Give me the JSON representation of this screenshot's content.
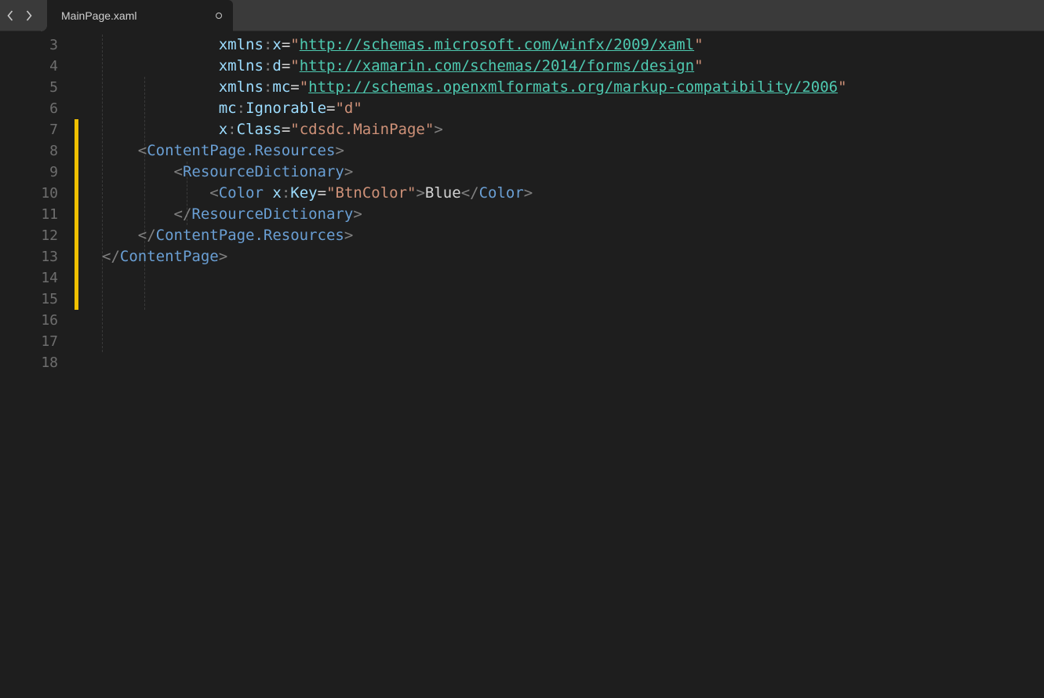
{
  "tab": {
    "label": "MainPage.xaml"
  },
  "lines": {
    "start": 3,
    "end": 18,
    "modified": [
      7,
      8,
      9,
      10,
      11,
      12,
      13,
      14,
      15
    ]
  },
  "code": {
    "l3": {
      "prefix": "xmlns",
      "ns": "x",
      "url": "http://schemas.microsoft.com/winfx/2009/xaml"
    },
    "l4": {
      "prefix": "xmlns",
      "ns": "d",
      "url": "http://xamarin.com/schemas/2014/forms/design"
    },
    "l5": {
      "prefix": "xmlns",
      "ns": "mc",
      "url": "http://schemas.openxmlformats.org/markup-compatibility/2006"
    },
    "l6": {
      "attr_ns": "mc",
      "attr": "Ignorable",
      "val": "d"
    },
    "l7": {
      "attr_ns": "x",
      "attr": "Class",
      "val": "cdsdc.MainPage"
    },
    "l9": {
      "tag": "ContentPage.Resources"
    },
    "l10": {
      "tag": "ResourceDictionary"
    },
    "l11": {
      "tag": "Color",
      "attr_ns": "x",
      "attr": "Key",
      "val": "BtnColor",
      "text": "Blue"
    },
    "l12": {
      "tag": "ResourceDictionary"
    },
    "l13": {
      "tag": "ContentPage.Resources"
    },
    "l17": {
      "tag": "ContentPage"
    }
  }
}
